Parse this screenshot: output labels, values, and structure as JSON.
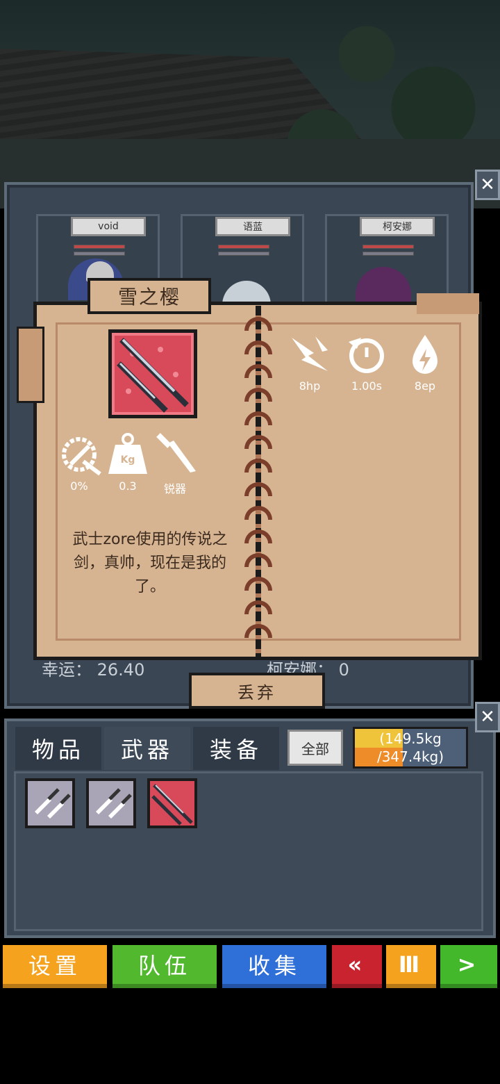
{
  "party": [
    {
      "name": "void"
    },
    {
      "name": "语蓝"
    },
    {
      "name": "柯安娜"
    }
  ],
  "background_stats": {
    "left": "幸运： 26.40",
    "right": "柯安娜： 0"
  },
  "item": {
    "title": "雪之樱",
    "attack": "8hp",
    "cooldown": "1.00s",
    "energy": "8ep",
    "crit": "0%",
    "weight": "0.3",
    "type": "锐器",
    "description": "武士zore使用的传说之剑，真帅，现在是我的了。",
    "weight_icon_text": "Kg"
  },
  "discard_label": "丢弃",
  "inventory": {
    "tabs": [
      "物品",
      "武器",
      "装备"
    ],
    "active_tab": "武器",
    "filter_label": "全部",
    "weight_current": "(149.5kg",
    "weight_max": "/347.4kg)",
    "weight_fraction": 0.43
  },
  "bottom_bar": {
    "settings": "设置",
    "team": "队伍",
    "collect": "收集",
    "rewind": "«",
    "pause": "Ⅲ",
    "play": ">"
  },
  "colors": {
    "settings": "#f5a21f",
    "team": "#52b82e",
    "collect": "#2f6fd8",
    "rewind": "#c8232f",
    "pause": "#f5a21f",
    "play": "#43b82b"
  }
}
